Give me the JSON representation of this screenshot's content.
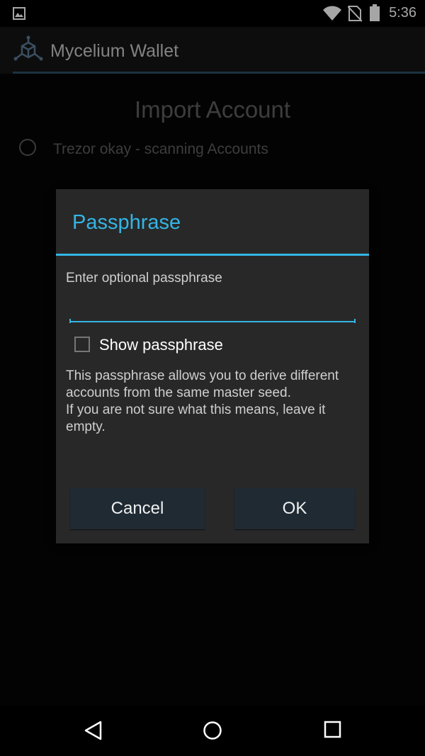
{
  "status_bar": {
    "time": "5:36",
    "icons": [
      "image-icon",
      "wifi-icon",
      "no-sim-icon",
      "battery-icon"
    ]
  },
  "app_bar": {
    "title": "Mycelium Wallet",
    "logo": "mycelium-logo-icon",
    "divider_color": "#2a4e66"
  },
  "page": {
    "heading": "Import Account",
    "status_text": "Trezor okay - scanning Accounts"
  },
  "dialog": {
    "title": "Passphrase",
    "accent_color": "#33b5e5",
    "prompt": "Enter optional passphrase",
    "input_value": "",
    "show_passphrase_label": "Show passphrase",
    "show_passphrase_checked": false,
    "description": "This passphrase allows you to derive different accounts from the same master seed.\nIf you are not sure what this means, leave it empty.",
    "cancel_label": "Cancel",
    "ok_label": "OK"
  },
  "nav_bar": {
    "icons": [
      "back-icon",
      "home-icon",
      "recents-icon"
    ]
  }
}
